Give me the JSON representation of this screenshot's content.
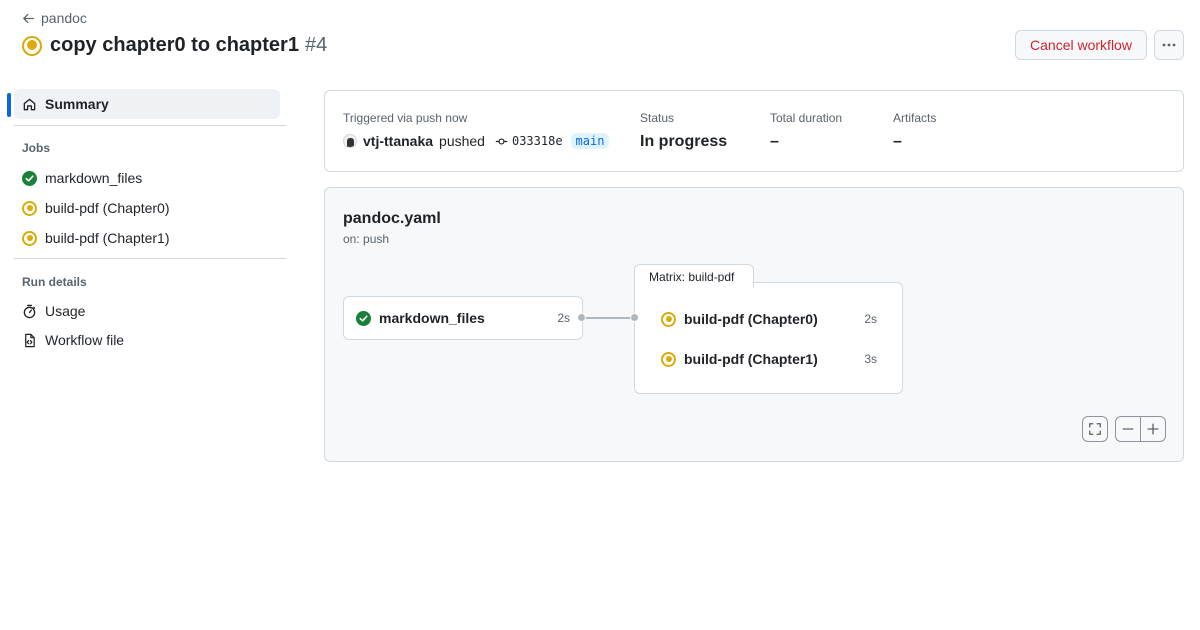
{
  "header": {
    "back_label": "pandoc",
    "run_title": "copy chapter0 to chapter1",
    "run_number": "#4",
    "cancel_label": "Cancel workflow",
    "more_icon": "kebab-horizontal-icon"
  },
  "sidebar": {
    "summary_label": "Summary",
    "jobs_heading": "Jobs",
    "jobs": [
      {
        "label": "markdown_files",
        "status": "success"
      },
      {
        "label": "build-pdf (Chapter0)",
        "status": "in_progress"
      },
      {
        "label": "build-pdf (Chapter1)",
        "status": "in_progress"
      }
    ],
    "run_details_heading": "Run details",
    "details": [
      {
        "label": "Usage",
        "icon": "stopwatch-icon"
      },
      {
        "label": "Workflow file",
        "icon": "file-code-icon"
      }
    ]
  },
  "summary": {
    "trigger_label": "Triggered via push now",
    "actor": "vtj-ttanaka",
    "action": "pushed",
    "commit": "033318e",
    "branch": "main",
    "status_label": "Status",
    "status_value": "In progress",
    "duration_label": "Total duration",
    "duration_value": "–",
    "artifacts_label": "Artifacts",
    "artifacts_value": "–"
  },
  "graph": {
    "workflow_file": "pandoc.yaml",
    "trigger": "on: push",
    "job": {
      "label": "markdown_files",
      "duration": "2s",
      "status": "success"
    },
    "matrix_label": "Matrix: build-pdf",
    "matrix_jobs": [
      {
        "label": "build-pdf (Chapter0)",
        "duration": "2s",
        "status": "in_progress"
      },
      {
        "label": "build-pdf (Chapter1)",
        "duration": "3s",
        "status": "in_progress"
      }
    ]
  },
  "colors": {
    "accent": "#0969da",
    "success": "#1a7f37",
    "in_progress": "#dbab0a",
    "danger": "#d1242f"
  }
}
